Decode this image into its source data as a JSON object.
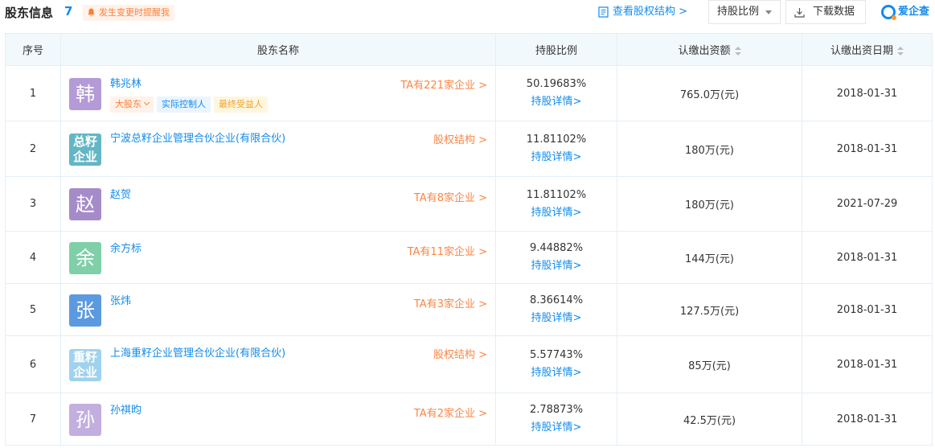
{
  "header": {
    "title": "股东信息",
    "count": "7",
    "remind_label": "发生变更时提醒我",
    "struct_link": "查看股权结构 >",
    "ratio_button": "持股比例",
    "download_button": "下载数据",
    "brand": "爱企查"
  },
  "table": {
    "columns": [
      "序号",
      "股东名称",
      "持股比例",
      "认缴出资额",
      "认缴出资日期"
    ],
    "detail_label": "持股详情>",
    "rows": [
      {
        "no": "1",
        "avatar": "韩",
        "avatar_color": "#b49ad6",
        "name": "韩兆林",
        "link": "TA有221家企业 >",
        "pct": "50.19683%",
        "amount": "765.0万(元)",
        "date": "2018-01-31",
        "tags": [
          "大股东",
          "实际控制人",
          "最终受益人"
        ]
      },
      {
        "no": "2",
        "avatar_top": "总籽",
        "avatar_bottom": "企业",
        "avatar_color": "#63b6c6",
        "name": "宁波总籽企业管理合伙企业(有限合伙)",
        "link": "股权结构 >",
        "pct": "11.81102%",
        "amount": "180万(元)",
        "date": "2018-01-31"
      },
      {
        "no": "3",
        "avatar": "赵",
        "avatar_color": "#a68bc9",
        "name": "赵贺",
        "link": "TA有8家企业 >",
        "pct": "11.81102%",
        "amount": "180万(元)",
        "date": "2021-07-29"
      },
      {
        "no": "4",
        "avatar": "余",
        "avatar_color": "#7fd0a9",
        "name": "余方标",
        "link": "TA有11家企业 >",
        "pct": "9.44882%",
        "amount": "144万(元)",
        "date": "2018-01-31"
      },
      {
        "no": "5",
        "avatar": "张",
        "avatar_color": "#5b9ae0",
        "name": "张炜",
        "link": "TA有3家企业 >",
        "pct": "8.36614%",
        "amount": "127.5万(元)",
        "date": "2018-01-31"
      },
      {
        "no": "6",
        "avatar_top": "重籽",
        "avatar_bottom": "企业",
        "avatar_color": "#9fd2ee",
        "name": "上海重籽企业管理合伙企业(有限合伙)",
        "link": "股权结构 >",
        "pct": "5.57743%",
        "amount": "85万(元)",
        "date": "2018-01-31"
      },
      {
        "no": "7",
        "avatar": "孙",
        "avatar_color": "#c2aedf",
        "name": "孙祺昀",
        "link": "TA有2家企业 >",
        "pct": "2.78873%",
        "amount": "42.5万(元)",
        "date": "2018-01-31"
      }
    ]
  }
}
